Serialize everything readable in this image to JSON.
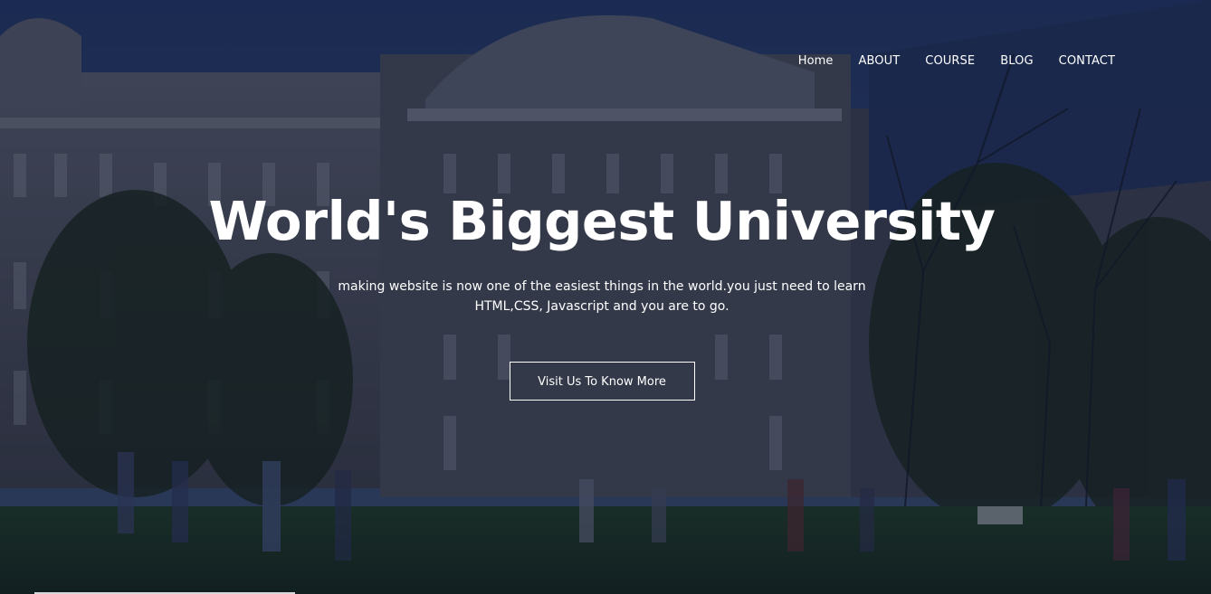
{
  "nav": {
    "items": [
      {
        "label": "Home"
      },
      {
        "label": "ABOUT"
      },
      {
        "label": "COURSE"
      },
      {
        "label": "BLOG"
      },
      {
        "label": "CONTACT"
      }
    ]
  },
  "hero": {
    "title": "World's Biggest University",
    "subtitle": "making website is now one of the easiest things in the world.you just need to learn HTML,CSS, Javascript and you are to go.",
    "cta_label": "Visit Us To Know More"
  },
  "colors": {
    "overlay": "#04091e",
    "text": "#ffffff",
    "sky": "#2b4173",
    "stone": "#5f6776",
    "lawn": "#25412b"
  }
}
